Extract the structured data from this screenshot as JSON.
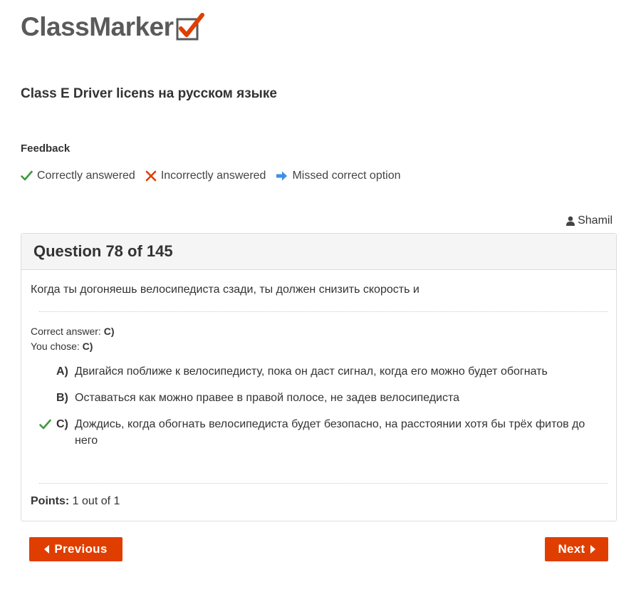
{
  "brand": {
    "name": "ClassMarker",
    "accent": "#e03e00"
  },
  "quiz": {
    "title": "Class E Driver licens на русском языке"
  },
  "feedback": {
    "heading": "Feedback",
    "legend": [
      {
        "icon": "check-icon",
        "label": "Correctly answered",
        "color": "#3c9a3c"
      },
      {
        "icon": "cross-icon",
        "label": "Incorrectly answered",
        "color": "#e03e00"
      },
      {
        "icon": "arrow-right-icon",
        "label": "Missed correct option",
        "color": "#3d8fe6"
      }
    ]
  },
  "user": {
    "icon": "user-icon",
    "name": "Shamil"
  },
  "question": {
    "header": "Question 78 of 145",
    "text": "Когда ты догоняешь велосипедиста сзади, ты должен снизить скорость и",
    "correct_label": "Correct answer:",
    "correct_value": "C)",
    "chose_label": "You chose:",
    "chose_value": "C)",
    "options": [
      {
        "letter": "A)",
        "text": "Двигайся поближе к велосипедисту, пока он даст сигнал, когда его можно будет обогнать",
        "mark": ""
      },
      {
        "letter": "B)",
        "text": "Оставаться как можно правее в правой полосе, не задев велосипедиста",
        "mark": ""
      },
      {
        "letter": "C)",
        "text": "Дождись, когда обогнать велосипедиста будет безопасно, на расстоянии хотя бы трёх фитов до него",
        "mark": "check-icon"
      }
    ],
    "points_label": "Points:",
    "points_value": "1 out of 1"
  },
  "nav": {
    "previous_label": "Previous",
    "next_label": "Next"
  }
}
